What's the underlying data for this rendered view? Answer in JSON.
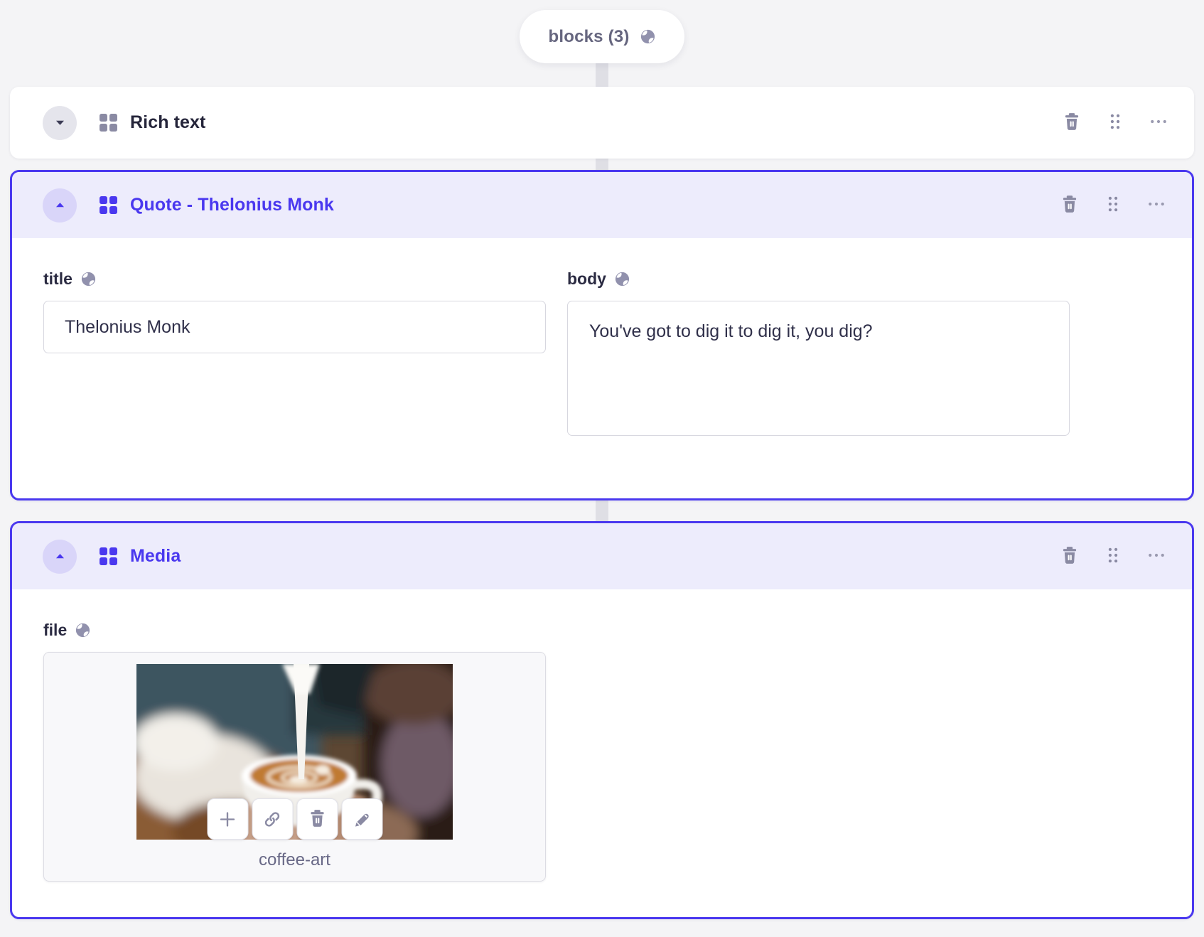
{
  "colors": {
    "accent": "#4a38ef",
    "page_background": "#f4f4f6",
    "selected_header_background": "#edecfc",
    "icon_gray": "#8a8aa3"
  },
  "pill": {
    "label": "blocks (3)",
    "icon": "globe-icon"
  },
  "blocks": {
    "rich_text": {
      "title": "Rich text",
      "state": "collapsed"
    },
    "quote": {
      "title": "Quote - Thelonius Monk",
      "state": "expanded",
      "fields": {
        "title": {
          "label": "title",
          "value": "Thelonius Monk"
        },
        "body": {
          "label": "body",
          "value": "You've got to dig it to dig it, you dig?"
        }
      }
    },
    "media": {
      "title": "Media",
      "state": "expanded",
      "fields": {
        "file": {
          "label": "file",
          "filename": "coffee-art"
        }
      }
    }
  }
}
